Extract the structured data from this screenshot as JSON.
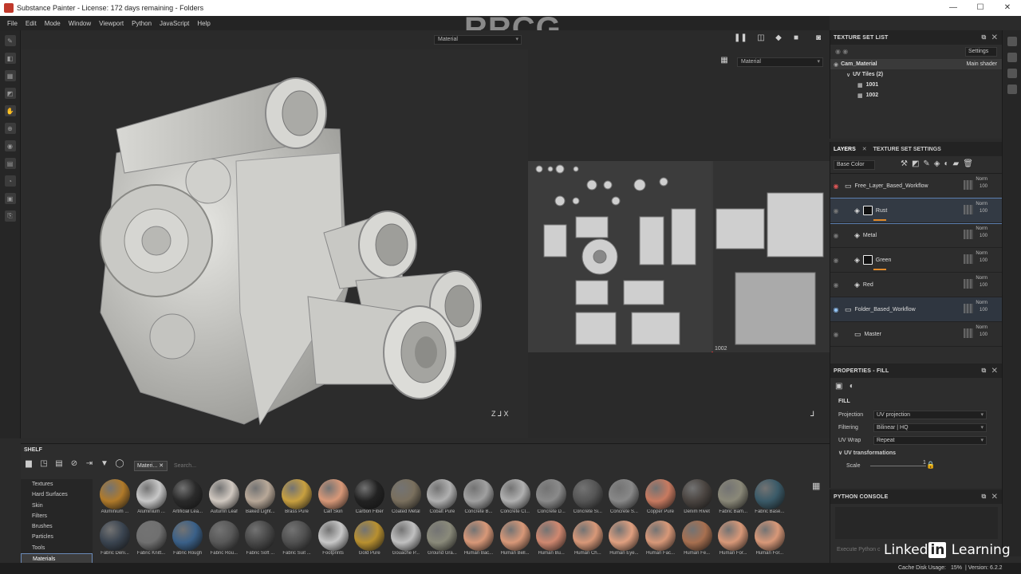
{
  "window": {
    "title": "Substance Painter - License: 172 days remaining - Folders",
    "controls": [
      "—",
      "☐",
      "✕"
    ]
  },
  "watermark": "RRCG",
  "menu": [
    "File",
    "Edit",
    "Mode",
    "Window",
    "Viewport",
    "Python",
    "JavaScript",
    "Help"
  ],
  "viewport": {
    "left_mode": "Material",
    "right_mode": "Material",
    "uv_tile_label": "1002"
  },
  "texture_set_list": {
    "title": "TEXTURE SET LIST",
    "settings_label": "Settings",
    "material_name": "Cam_Material",
    "shader": "Main shader",
    "uv_tiles_label": "UV Tiles (2)",
    "tiles": [
      "1001",
      "1002"
    ]
  },
  "layers": {
    "tab_layers": "LAYERS",
    "tab_settings": "TEXTURE SET SETTINGS",
    "channel": "Base Color",
    "items": [
      {
        "name": "Free_Layer_Based_Workflow",
        "type": "folder",
        "blend": "Norm",
        "opacity": "100",
        "indent": 0
      },
      {
        "name": "Rust",
        "type": "fill-mask",
        "blend": "Norm",
        "opacity": "100",
        "indent": 1
      },
      {
        "name": "Metal",
        "type": "fill",
        "blend": "Norm",
        "opacity": "100",
        "indent": 1
      },
      {
        "name": "Green",
        "type": "fill-mask",
        "blend": "Norm",
        "opacity": "100",
        "indent": 1
      },
      {
        "name": "Red",
        "type": "fill",
        "blend": "Norm",
        "opacity": "100",
        "indent": 1
      },
      {
        "name": "Folder_Based_Workflow",
        "type": "folder",
        "blend": "Norm",
        "opacity": "100",
        "indent": 0
      },
      {
        "name": "Master",
        "type": "folder",
        "blend": "Norm",
        "opacity": "100",
        "indent": 1
      }
    ]
  },
  "properties": {
    "title": "PROPERTIES - FILL",
    "section": "FILL",
    "projection_label": "Projection",
    "projection_value": "UV projection",
    "filtering_label": "Filtering",
    "filtering_value": "Bilinear | HQ",
    "uvwrap_label": "UV Wrap",
    "uvwrap_value": "Repeat",
    "uv_transform_label": "UV transformations",
    "scale_label": "Scale",
    "scale_value": "1"
  },
  "python_console": {
    "title": "PYTHON CONSOLE",
    "placeholder": "Execute Python c"
  },
  "shelf": {
    "title": "SHELF",
    "filter_tag": "Materi...",
    "search_placeholder": "Search...",
    "categories": [
      "Textures",
      "Hard Surfaces",
      "Skin",
      "Filters",
      "Brushes",
      "Particles",
      "Tools",
      "Materials"
    ],
    "selected_category": "Materials",
    "materials_row1": [
      {
        "name": "Aluminium ...",
        "color": "#b07a2a"
      },
      {
        "name": "Aluminium ...",
        "color": "#c8c8c8"
      },
      {
        "name": "Artificial Lea...",
        "color": "#2a2a2a"
      },
      {
        "name": "Autumn Leaf",
        "color": "#d0c8c0"
      },
      {
        "name": "Baked Light...",
        "color": "#b8a898"
      },
      {
        "name": "Brass Pure",
        "color": "#c8a040"
      },
      {
        "name": "Calf Skin",
        "color": "#d89878"
      },
      {
        "name": "Carbon Fiber",
        "color": "#222222"
      },
      {
        "name": "Coated Metal",
        "color": "#7a705e"
      },
      {
        "name": "Cobalt Pure",
        "color": "#b0b0b0"
      },
      {
        "name": "Concrete B...",
        "color": "#a0a0a0"
      },
      {
        "name": "Concrete Cl...",
        "color": "#b0b0b0"
      },
      {
        "name": "Concrete D...",
        "color": "#8a8a8a"
      },
      {
        "name": "Concrete Si...",
        "color": "#555555"
      },
      {
        "name": "Concrete S...",
        "color": "#888888"
      },
      {
        "name": "Copper Pure",
        "color": "#c87a60"
      },
      {
        "name": "Denim Rivet",
        "color": "#4a4440"
      },
      {
        "name": "Fabric Bam...",
        "color": "#8a8878"
      },
      {
        "name": "Fabric Base...",
        "color": "#3a5a68"
      }
    ],
    "materials_row2": [
      {
        "name": "Fabric Deni...",
        "color": "#3a4450"
      },
      {
        "name": "Fabric Knitt...",
        "color": "#707070"
      },
      {
        "name": "Fabric Rough",
        "color": "#3a6088"
      },
      {
        "name": "Fabric Rou...",
        "color": "#585858"
      },
      {
        "name": "Fabric Soft ...",
        "color": "#484848"
      },
      {
        "name": "Fabric Suit ...",
        "color": "#505050"
      },
      {
        "name": "Footprints",
        "color": "#c8c8c8"
      },
      {
        "name": "Gold Pure",
        "color": "#b89030"
      },
      {
        "name": "Gouache P...",
        "color": "#c0c0c0"
      },
      {
        "name": "Ground Gra...",
        "color": "#8a8a7a"
      },
      {
        "name": "Human Bac...",
        "color": "#d89878"
      },
      {
        "name": "Human Bell...",
        "color": "#d89878"
      },
      {
        "name": "Human Bu...",
        "color": "#d08870"
      },
      {
        "name": "Human Ch...",
        "color": "#d89878"
      },
      {
        "name": "Human Eye...",
        "color": "#e0a080"
      },
      {
        "name": "Human Fac...",
        "color": "#d89878"
      },
      {
        "name": "Human Fe...",
        "color": "#a87050"
      },
      {
        "name": "Human For...",
        "color": "#d89878"
      },
      {
        "name": "Human For...",
        "color": "#d89878"
      }
    ]
  },
  "status": {
    "cache_label": "Cache Disk Usage:",
    "cache_value": "15%",
    "version": "| Version: 6.2.2"
  },
  "branding": {
    "linkedin_a": "Linked",
    "linkedin_b": "in",
    "linkedin_c": " Learning"
  }
}
